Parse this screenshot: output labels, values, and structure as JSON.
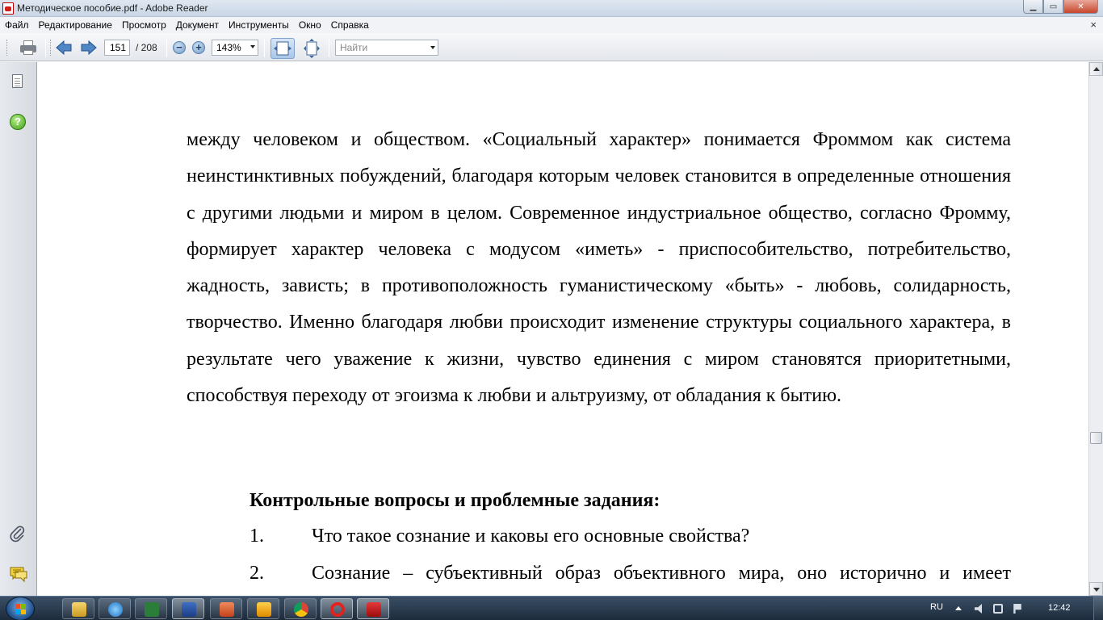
{
  "window": {
    "title": "Методическое пособие.pdf - Adobe Reader",
    "minimize_glyph": "▁",
    "maximize_glyph": "▭",
    "close_glyph": "✕"
  },
  "menu": {
    "items": [
      "Файл",
      "Редактирование",
      "Просмотр",
      "Документ",
      "Инструменты",
      "Окно",
      "Справка"
    ],
    "close_glyph": "×"
  },
  "toolbar": {
    "current_page": "151",
    "page_total": "/ 208",
    "zoom_out_glyph": "−",
    "zoom_in_glyph": "+",
    "zoom_value": "143%",
    "find_placeholder": "Найти",
    "icons": [
      "print-icon",
      "previous-page-icon",
      "next-page-icon",
      "zoom-out-icon",
      "zoom-in-icon",
      "fit-width-icon",
      "fit-page-icon"
    ]
  },
  "nav_panel": {
    "help_glyph": "?",
    "icons": [
      "pages-icon",
      "help-icon",
      "attachments-icon",
      "comments-icon"
    ]
  },
  "document": {
    "paragraph": "между человеком и обществом. «Социальный характер» понимается Фроммом как система неинстинктивных побуждений, благодаря которым человек становится в определенные отношения с другими людьми и миром в целом. Современное индустриальное общество, согласно Фромму, формирует характер человека с модусом «иметь» - приспособительство, потребительство, жадность, зависть; в противоположность гуманистическому «быть» - любовь, солидарность, творчество. Именно благодаря любви происходит изменение структуры социального характера, в результате чего уважение к жизни, чувство единения с миром становятся приоритетными, способствуя переходу от эгоизма к любви и альтруизму, от обладания к бытию.",
    "heading": "Контрольные вопросы и проблемные задания:",
    "questions": [
      {
        "number": "1.",
        "text": "Что такое сознание и каковы его основные свойства?"
      },
      {
        "number": "2.",
        "text": "Сознание – субъективный образ объективного мира, оно исторично и имеет"
      }
    ]
  },
  "taskbar": {
    "apps": [
      "explorer",
      "internet-explorer",
      "pdf-tool",
      "word",
      "presentation",
      "media-player",
      "chrome",
      "opera",
      "adobe-reader"
    ],
    "active_app": "adobe-reader",
    "language": "RU",
    "clock": "12:42"
  },
  "colors": {
    "accent_blue": "#1e4f8a",
    "reader_red": "#d41c1c",
    "help_green": "#3f9e16"
  }
}
